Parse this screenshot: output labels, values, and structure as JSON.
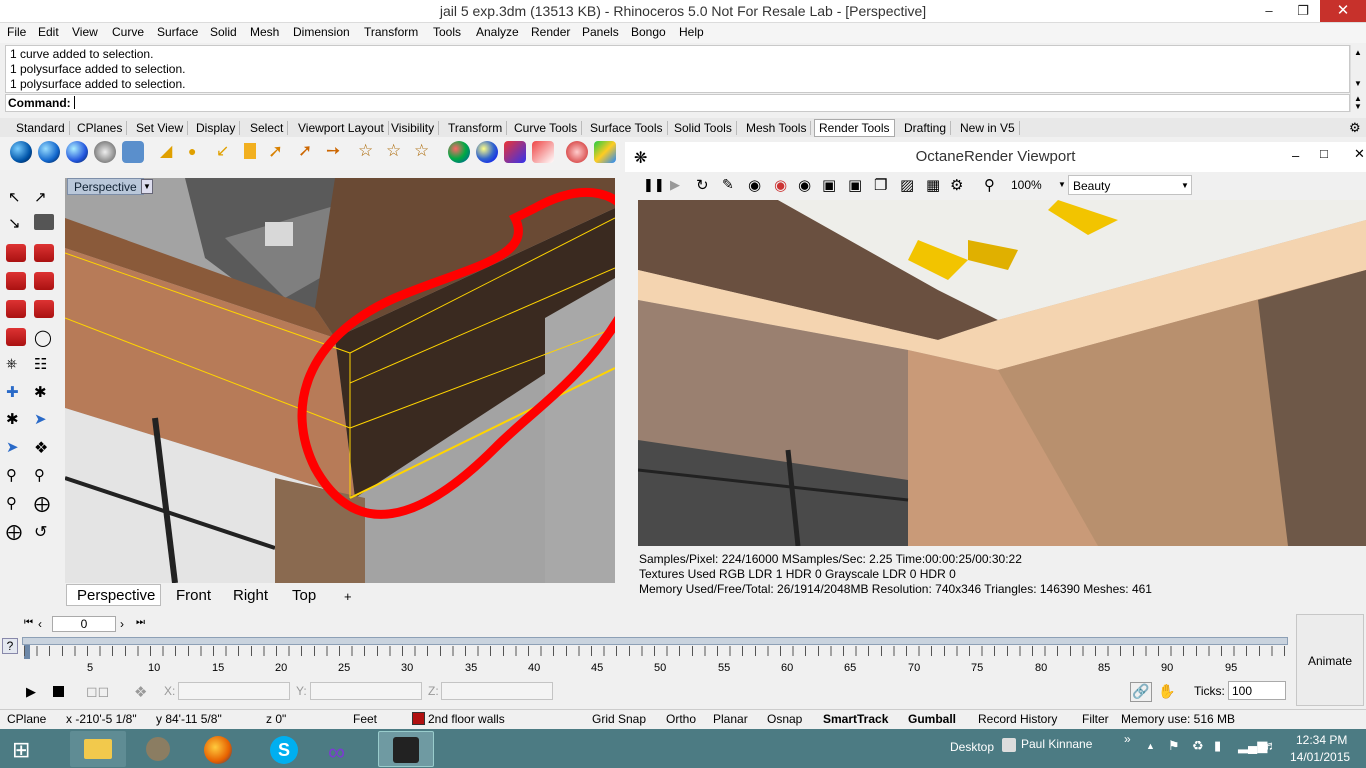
{
  "window": {
    "title": "jail 5 exp.3dm (13513 KB) - Rhinoceros 5.0 Not For Resale Lab - [Perspective]"
  },
  "menu": [
    "File",
    "Edit",
    "View",
    "Curve",
    "Surface",
    "Solid",
    "Mesh",
    "Dimension",
    "Transform",
    "Tools",
    "Analyze",
    "Render",
    "Panels",
    "Bongo",
    "Help"
  ],
  "command": {
    "history": [
      "1 curve added to selection.",
      "1 polysurface added to selection.",
      "1 polysurface added to selection."
    ],
    "prompt": "Command:"
  },
  "toolbar_tabs": [
    "Standard",
    "CPlanes",
    "Set View",
    "Display",
    "Select",
    "Viewport Layout",
    "Visibility",
    "Transform",
    "Curve Tools",
    "Surface Tools",
    "Solid Tools",
    "Mesh Tools",
    "Render Tools",
    "Drafting",
    "New in V5"
  ],
  "viewport": {
    "active_label": "Perspective",
    "tabs": [
      "Perspective",
      "Front",
      "Right",
      "Top"
    ],
    "add_tab": "+"
  },
  "octane": {
    "title": "OctaneRender Viewport",
    "zoom": "100%",
    "pass": "Beauty",
    "info": [
      "Samples/Pixel: 224/16000  MSamples/Sec: 2.25  Time:00:00:25/00:30:22",
      "Textures Used RGB LDR 1  HDR 0  Grayscale LDR 0  HDR 0",
      "Memory Used/Free/Total: 26/1914/2048MB  Resolution: 740x346  Triangles: 146390  Meshes:  461"
    ]
  },
  "timeline": {
    "frame": "0",
    "ticks_labels": [
      "5",
      "10",
      "15",
      "20",
      "25",
      "30",
      "35",
      "40",
      "45",
      "50",
      "55",
      "60",
      "65",
      "70",
      "75",
      "80",
      "85",
      "90",
      "95"
    ],
    "x_label": "X:",
    "y_label": "Y:",
    "z_label": "Z:",
    "ticks_label": "Ticks:",
    "ticks_value": "100",
    "animate": "Animate",
    "help": "?"
  },
  "status": {
    "cplane": "CPlane",
    "x": "x -210'-5 1/8\"",
    "y": "y 84'-11 5/8\"",
    "z": "z 0\"",
    "units": "Feet",
    "layer": "2nd floor walls",
    "layer_color": "#b01010",
    "toggles": [
      "Grid Snap",
      "Ortho",
      "Planar",
      "Osnap",
      "SmartTrack",
      "Gumball",
      "Record History",
      "Filter"
    ],
    "memory": "Memory use: 516 MB"
  },
  "taskbar": {
    "desktop": "Desktop",
    "user": "Paul Kinnane",
    "time": "12:34 PM",
    "date": "14/01/2015",
    "chevron": "»"
  }
}
